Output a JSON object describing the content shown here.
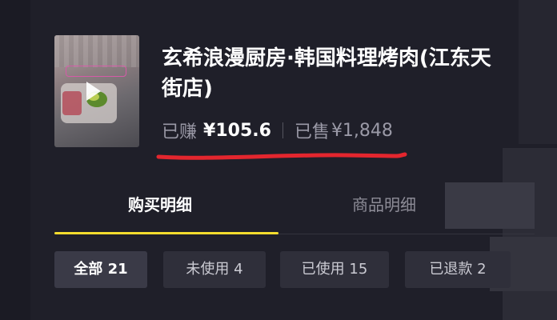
{
  "product": {
    "title": "玄希浪漫厨房·韩国料理烤肉(江东天街店)",
    "earned_label": "已赚",
    "earned_value": "¥105.6",
    "sold_label": "已售",
    "sold_value": "¥1,848",
    "thumbnail_icon": "play-icon"
  },
  "tabs": [
    {
      "label": "购买明细",
      "active": true
    },
    {
      "label": "商品明细",
      "active": false
    }
  ],
  "filters": [
    {
      "label": "全部 21",
      "active": true
    },
    {
      "label": "未使用 4",
      "active": false
    },
    {
      "label": "已使用 15",
      "active": false
    },
    {
      "label": "已退款 2",
      "active": false
    }
  ],
  "colors": {
    "background": "#1f1f29",
    "tab_indicator": "#f4dc2e",
    "annotation_underline": "#e3262e"
  }
}
